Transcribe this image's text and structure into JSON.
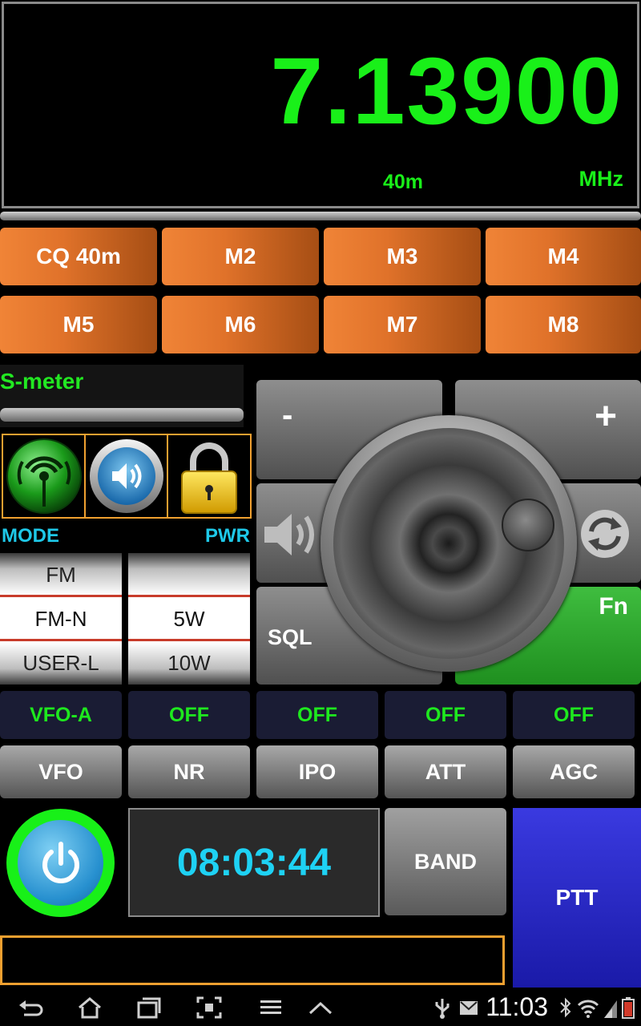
{
  "display": {
    "frequency": "7.13900",
    "band": "40m",
    "unit": "MHz"
  },
  "memories": [
    "CQ 40m",
    "M2",
    "M3",
    "M4",
    "M5",
    "M6",
    "M7",
    "M8"
  ],
  "smeter": {
    "label": "S-meter"
  },
  "labels": {
    "mode": "MODE",
    "pwr": "PWR"
  },
  "mode_wheel": {
    "items": [
      "FM",
      "FM-N",
      "USER-L"
    ],
    "selected": "FM-N"
  },
  "power_wheel": {
    "items": [
      "",
      "5W",
      "10W"
    ],
    "selected": "5W"
  },
  "tuning": {
    "minus": "-",
    "plus": "+",
    "sql": "SQL",
    "fn": "Fn"
  },
  "status": [
    "VFO-A",
    "OFF",
    "OFF",
    "OFF",
    "OFF"
  ],
  "functions": [
    "VFO",
    "NR",
    "IPO",
    "ATT",
    "AGC"
  ],
  "clock": "08:03:44",
  "band_button": "BAND",
  "ptt_button": "PTT",
  "system": {
    "time": "11:03"
  },
  "colors": {
    "freq_green": "#19f019",
    "memory_orange": "#e0722a",
    "ptt_blue": "#2a2ad0",
    "accent_cyan": "#1ed2f4"
  }
}
